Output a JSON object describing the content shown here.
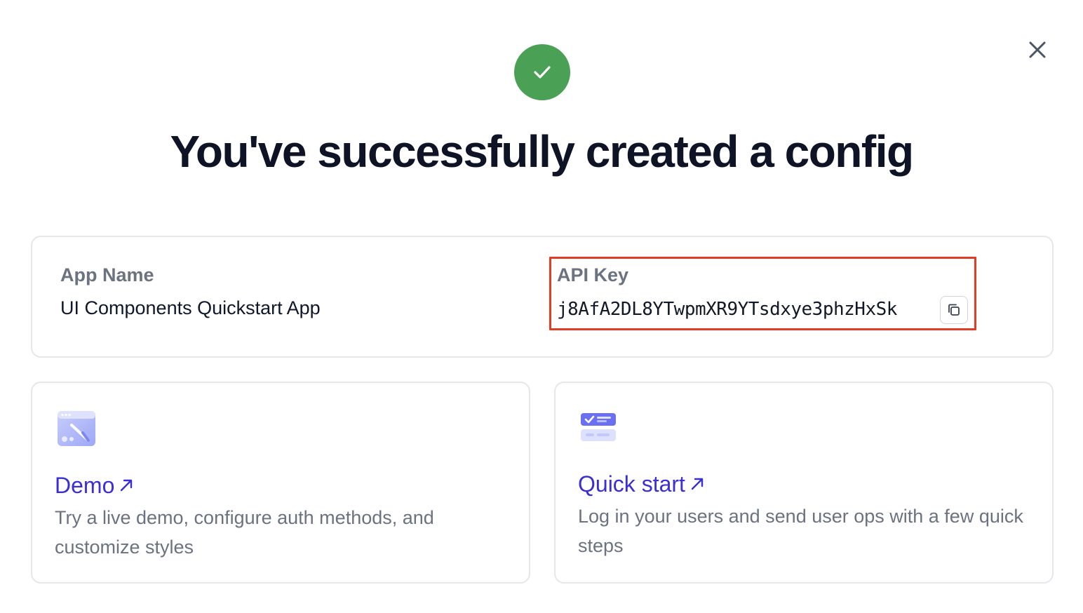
{
  "header": {
    "title": "You've successfully created a config",
    "success_icon": "check-icon",
    "close_icon": "close-icon"
  },
  "config": {
    "app_name_label": "App Name",
    "app_name_value": "UI Components Quickstart App",
    "api_key_label": "API Key",
    "api_key_value": "j8AfA2DL8YTwpmXR9YTsdxye3phzHxSk",
    "copy_icon": "copy-icon"
  },
  "cards": {
    "demo": {
      "title": "Demo",
      "description": "Try a live demo, configure auth methods, and customize styles",
      "icon": "demo-window-brush-icon"
    },
    "quickstart": {
      "title": "Quick start",
      "description": "Log in your users and send user ops with a few quick steps",
      "icon": "checklist-icon"
    }
  },
  "colors": {
    "success": "#4aa054",
    "link": "#3b2ed6",
    "highlight": "#e03d25",
    "muted_text": "#6b7280"
  }
}
